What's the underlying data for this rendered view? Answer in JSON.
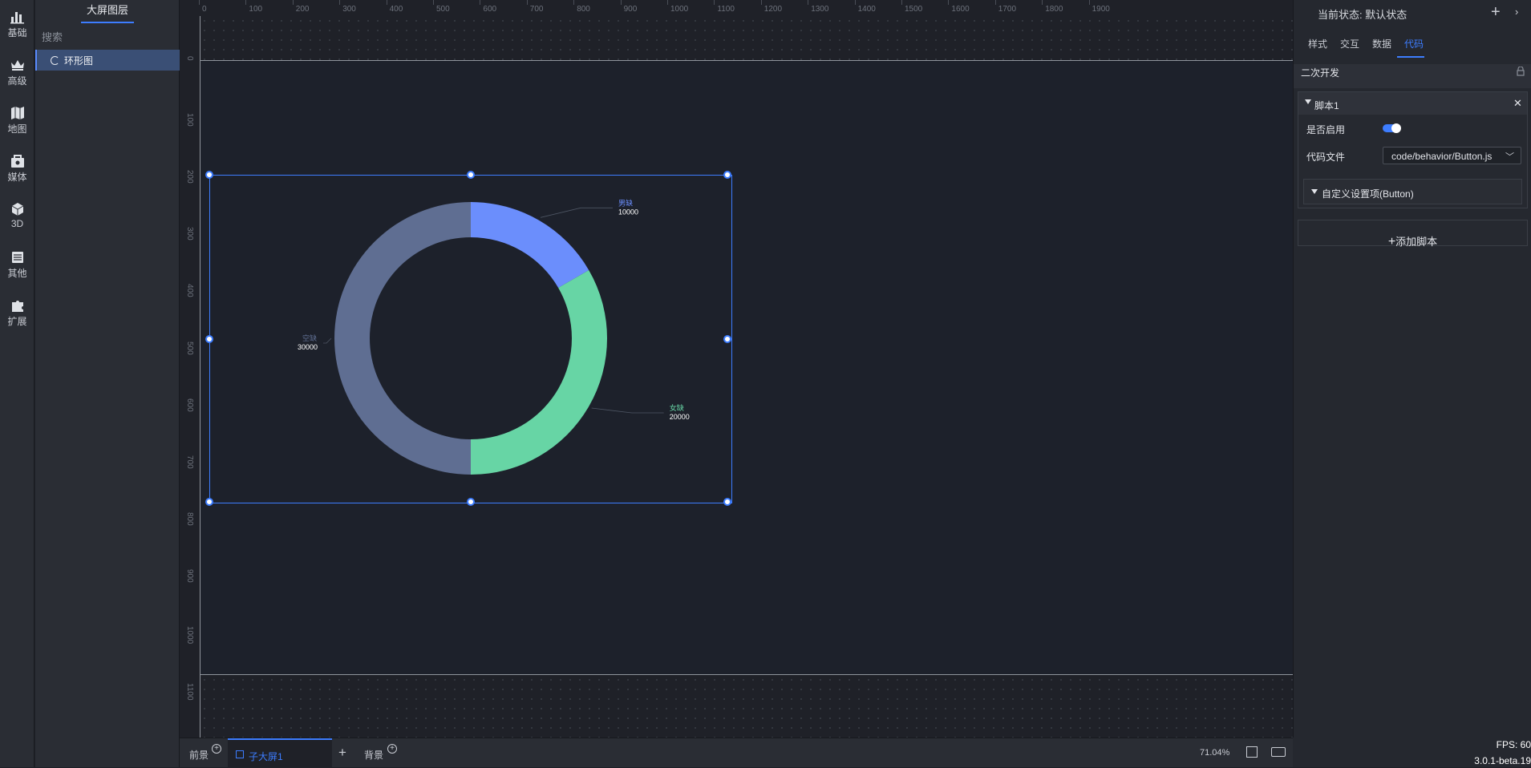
{
  "leftbar": {
    "items": [
      {
        "label": "基础",
        "icon": "bar-chart-icon"
      },
      {
        "label": "高级",
        "icon": "crown-icon"
      },
      {
        "label": "地图",
        "icon": "map-icon"
      },
      {
        "label": "媒体",
        "icon": "media-bag-icon"
      },
      {
        "label": "3D",
        "icon": "cube-icon"
      },
      {
        "label": "其他",
        "icon": "list-icon"
      },
      {
        "label": "扩展",
        "icon": "puzzle-icon"
      }
    ]
  },
  "layers": {
    "title": "大屏图层",
    "search_placeholder": "搜索",
    "items": [
      {
        "label": "环形图",
        "icon": "ring-icon"
      }
    ]
  },
  "ruler": {
    "horizontal": [
      "0",
      "100",
      "200",
      "300",
      "400",
      "500",
      "600",
      "700",
      "800",
      "900",
      "1000",
      "1100",
      "1200",
      "1300",
      "1400",
      "1500",
      "1600",
      "1700",
      "1800",
      "1900"
    ],
    "vertical": [
      "0",
      "100",
      "200",
      "300",
      "400",
      "500",
      "600",
      "700",
      "800",
      "900",
      "1000",
      "1100"
    ]
  },
  "chart_data": {
    "type": "pie",
    "variant": "donut",
    "categories": [
      "男缺",
      "女缺",
      "空缺"
    ],
    "values": [
      10000,
      20000,
      30000
    ],
    "colors": [
      "#6b8efc",
      "#67d5a5",
      "#5f6e92"
    ]
  },
  "rightpanel": {
    "state_label": "当前状态:",
    "state_value": "默认状态",
    "tabs": [
      "样式",
      "交互",
      "数据",
      "代码"
    ],
    "active_tab": "代码",
    "section": "二次开发",
    "script": {
      "title": "脚本1",
      "enable_label": "是否启用",
      "enabled": true,
      "file_label": "代码文件",
      "file_value": "code/behavior/Button.js",
      "custom_label": "自定义设置项(Button)"
    },
    "add_script": "添加脚本"
  },
  "bottombar": {
    "foreground": "前景",
    "subscreen": "子大屏1",
    "background": "背景",
    "zoom": "71.04%"
  },
  "status": {
    "fps": "FPS: 60",
    "version": "3.0.1-beta.19"
  },
  "colors": {
    "accent": "#3d7dff"
  }
}
